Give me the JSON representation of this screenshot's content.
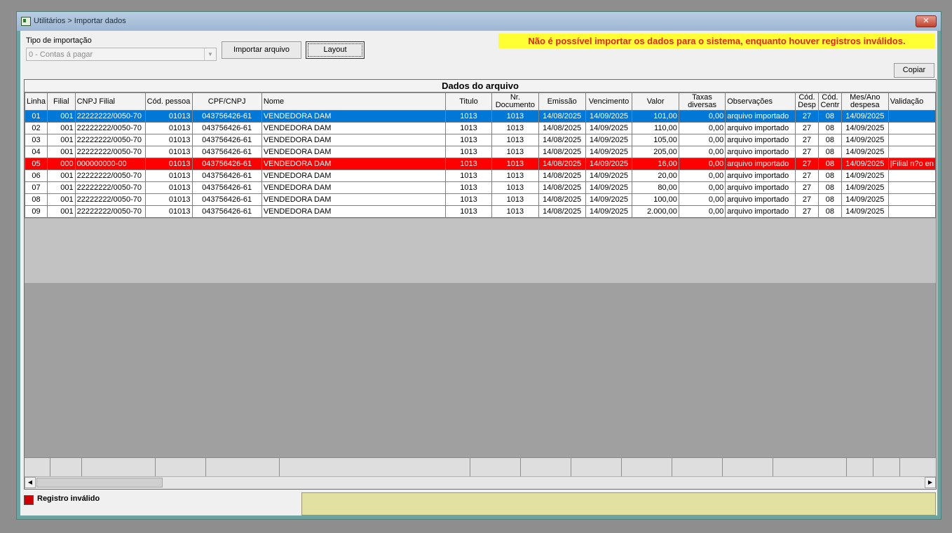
{
  "window": {
    "title": "Utilitários > Importar dados",
    "close_label": "✕"
  },
  "toolbar": {
    "tipo_label": "Tipo de importação",
    "tipo_value": "0 - Contas á pagar",
    "import_label": "Importar arquivo",
    "layout_label": "Layout",
    "copy_label": "Copiar"
  },
  "warning": "Não é possível importar os dados para o sistema, enquanto houver registros inválidos.",
  "grid": {
    "title": "Dados do arquivo",
    "columns": [
      "Linha",
      "Filial",
      "CNPJ Filial",
      "Cód. pessoa",
      "CPF/CNPJ",
      "Nome",
      "Titulo",
      "Nr. Documento",
      "Emissão",
      "Vencimento",
      "Valor",
      "Taxas diversas",
      "Observações",
      "Cód. Desp",
      "Cód. Centr",
      "Mes/Ano despesa",
      "Validação"
    ],
    "rows": [
      [
        "01",
        "001",
        "22222222/0050-70",
        "01013",
        "043756426-61",
        "VENDEDORA DAM",
        "1013",
        "1013",
        "14/08/2025",
        "14/09/2025",
        "101,00",
        "0,00",
        "arquivo importado",
        "27",
        "08",
        "14/09/2025",
        ""
      ],
      [
        "02",
        "001",
        "22222222/0050-70",
        "01013",
        "043756426-61",
        "VENDEDORA DAM",
        "1013",
        "1013",
        "14/08/2025",
        "14/09/2025",
        "110,00",
        "0,00",
        "arquivo importado",
        "27",
        "08",
        "14/09/2025",
        ""
      ],
      [
        "03",
        "001",
        "22222222/0050-70",
        "01013",
        "043756426-61",
        "VENDEDORA DAM",
        "1013",
        "1013",
        "14/08/2025",
        "14/09/2025",
        "105,00",
        "0,00",
        "arquivo importado",
        "27",
        "08",
        "14/09/2025",
        ""
      ],
      [
        "04",
        "001",
        "22222222/0050-70",
        "01013",
        "043756426-61",
        "VENDEDORA DAM",
        "1013",
        "1013",
        "14/08/2025",
        "14/09/2025",
        "205,00",
        "0,00",
        "arquivo importado",
        "27",
        "08",
        "14/09/2025",
        ""
      ],
      [
        "05",
        "000",
        "000000000-00",
        "01013",
        "043756426-61",
        "VENDEDORA DAM",
        "1013",
        "1013",
        "14/08/2025",
        "14/09/2025",
        "16,00",
        "0,00",
        "arquivo importado",
        "27",
        "08",
        "14/09/2025",
        "|Filial n?o en"
      ],
      [
        "06",
        "001",
        "22222222/0050-70",
        "01013",
        "043756426-61",
        "VENDEDORA DAM",
        "1013",
        "1013",
        "14/08/2025",
        "14/09/2025",
        "20,00",
        "0,00",
        "arquivo importado",
        "27",
        "08",
        "14/09/2025",
        ""
      ],
      [
        "07",
        "001",
        "22222222/0050-70",
        "01013",
        "043756426-61",
        "VENDEDORA DAM",
        "1013",
        "1013",
        "14/08/2025",
        "14/09/2025",
        "80,00",
        "0,00",
        "arquivo importado",
        "27",
        "08",
        "14/09/2025",
        ""
      ],
      [
        "08",
        "001",
        "22222222/0050-70",
        "01013",
        "043756426-61",
        "VENDEDORA DAM",
        "1013",
        "1013",
        "14/08/2025",
        "14/09/2025",
        "100,00",
        "0,00",
        "arquivo importado",
        "27",
        "08",
        "14/09/2025",
        ""
      ],
      [
        "09",
        "001",
        "22222222/0050-70",
        "01013",
        "043756426-61",
        "VENDEDORA DAM",
        "1013",
        "1013",
        "14/08/2025",
        "14/09/2025",
        "2.000,00",
        "0,00",
        "arquivo importado",
        "27",
        "08",
        "14/09/2025",
        ""
      ]
    ],
    "selected_row": 0,
    "invalid_row": 4
  },
  "legend": {
    "label": "Registro inválido",
    "color": "#d10000"
  },
  "colors": {
    "selection": "#0078d7",
    "invalid": "#ff0000",
    "warning_bg": "#ffff33",
    "warning_text": "#e1251b"
  }
}
